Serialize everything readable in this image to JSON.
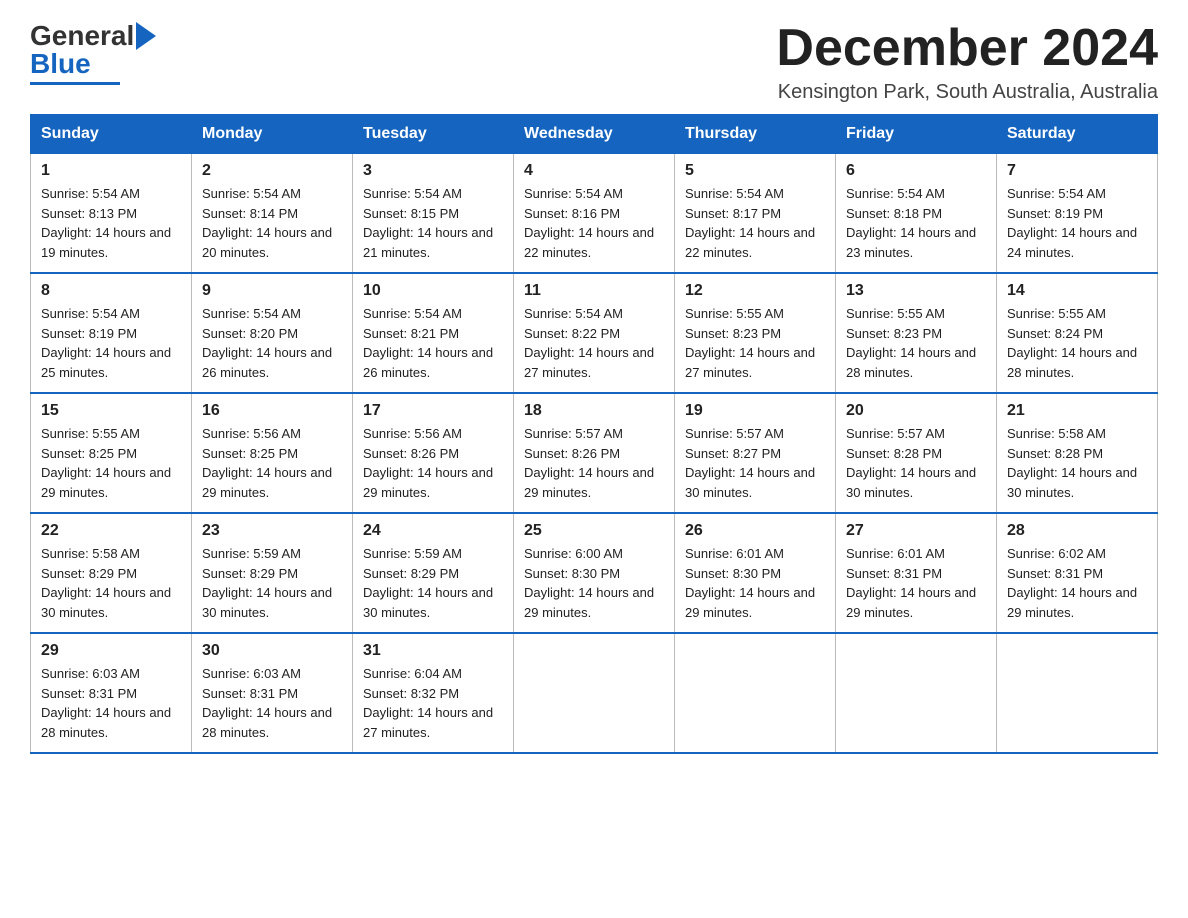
{
  "logo": {
    "general": "General",
    "blue": "Blue"
  },
  "header": {
    "month": "December 2024",
    "location": "Kensington Park, South Australia, Australia"
  },
  "weekdays": [
    "Sunday",
    "Monday",
    "Tuesday",
    "Wednesday",
    "Thursday",
    "Friday",
    "Saturday"
  ],
  "weeks": [
    [
      {
        "day": "1",
        "sunrise": "5:54 AM",
        "sunset": "8:13 PM",
        "daylight": "14 hours and 19 minutes."
      },
      {
        "day": "2",
        "sunrise": "5:54 AM",
        "sunset": "8:14 PM",
        "daylight": "14 hours and 20 minutes."
      },
      {
        "day": "3",
        "sunrise": "5:54 AM",
        "sunset": "8:15 PM",
        "daylight": "14 hours and 21 minutes."
      },
      {
        "day": "4",
        "sunrise": "5:54 AM",
        "sunset": "8:16 PM",
        "daylight": "14 hours and 22 minutes."
      },
      {
        "day": "5",
        "sunrise": "5:54 AM",
        "sunset": "8:17 PM",
        "daylight": "14 hours and 22 minutes."
      },
      {
        "day": "6",
        "sunrise": "5:54 AM",
        "sunset": "8:18 PM",
        "daylight": "14 hours and 23 minutes."
      },
      {
        "day": "7",
        "sunrise": "5:54 AM",
        "sunset": "8:19 PM",
        "daylight": "14 hours and 24 minutes."
      }
    ],
    [
      {
        "day": "8",
        "sunrise": "5:54 AM",
        "sunset": "8:19 PM",
        "daylight": "14 hours and 25 minutes."
      },
      {
        "day": "9",
        "sunrise": "5:54 AM",
        "sunset": "8:20 PM",
        "daylight": "14 hours and 26 minutes."
      },
      {
        "day": "10",
        "sunrise": "5:54 AM",
        "sunset": "8:21 PM",
        "daylight": "14 hours and 26 minutes."
      },
      {
        "day": "11",
        "sunrise": "5:54 AM",
        "sunset": "8:22 PM",
        "daylight": "14 hours and 27 minutes."
      },
      {
        "day": "12",
        "sunrise": "5:55 AM",
        "sunset": "8:23 PM",
        "daylight": "14 hours and 27 minutes."
      },
      {
        "day": "13",
        "sunrise": "5:55 AM",
        "sunset": "8:23 PM",
        "daylight": "14 hours and 28 minutes."
      },
      {
        "day": "14",
        "sunrise": "5:55 AM",
        "sunset": "8:24 PM",
        "daylight": "14 hours and 28 minutes."
      }
    ],
    [
      {
        "day": "15",
        "sunrise": "5:55 AM",
        "sunset": "8:25 PM",
        "daylight": "14 hours and 29 minutes."
      },
      {
        "day": "16",
        "sunrise": "5:56 AM",
        "sunset": "8:25 PM",
        "daylight": "14 hours and 29 minutes."
      },
      {
        "day": "17",
        "sunrise": "5:56 AM",
        "sunset": "8:26 PM",
        "daylight": "14 hours and 29 minutes."
      },
      {
        "day": "18",
        "sunrise": "5:57 AM",
        "sunset": "8:26 PM",
        "daylight": "14 hours and 29 minutes."
      },
      {
        "day": "19",
        "sunrise": "5:57 AM",
        "sunset": "8:27 PM",
        "daylight": "14 hours and 30 minutes."
      },
      {
        "day": "20",
        "sunrise": "5:57 AM",
        "sunset": "8:28 PM",
        "daylight": "14 hours and 30 minutes."
      },
      {
        "day": "21",
        "sunrise": "5:58 AM",
        "sunset": "8:28 PM",
        "daylight": "14 hours and 30 minutes."
      }
    ],
    [
      {
        "day": "22",
        "sunrise": "5:58 AM",
        "sunset": "8:29 PM",
        "daylight": "14 hours and 30 minutes."
      },
      {
        "day": "23",
        "sunrise": "5:59 AM",
        "sunset": "8:29 PM",
        "daylight": "14 hours and 30 minutes."
      },
      {
        "day": "24",
        "sunrise": "5:59 AM",
        "sunset": "8:29 PM",
        "daylight": "14 hours and 30 minutes."
      },
      {
        "day": "25",
        "sunrise": "6:00 AM",
        "sunset": "8:30 PM",
        "daylight": "14 hours and 29 minutes."
      },
      {
        "day": "26",
        "sunrise": "6:01 AM",
        "sunset": "8:30 PM",
        "daylight": "14 hours and 29 minutes."
      },
      {
        "day": "27",
        "sunrise": "6:01 AM",
        "sunset": "8:31 PM",
        "daylight": "14 hours and 29 minutes."
      },
      {
        "day": "28",
        "sunrise": "6:02 AM",
        "sunset": "8:31 PM",
        "daylight": "14 hours and 29 minutes."
      }
    ],
    [
      {
        "day": "29",
        "sunrise": "6:03 AM",
        "sunset": "8:31 PM",
        "daylight": "14 hours and 28 minutes."
      },
      {
        "day": "30",
        "sunrise": "6:03 AM",
        "sunset": "8:31 PM",
        "daylight": "14 hours and 28 minutes."
      },
      {
        "day": "31",
        "sunrise": "6:04 AM",
        "sunset": "8:32 PM",
        "daylight": "14 hours and 27 minutes."
      },
      null,
      null,
      null,
      null
    ]
  ]
}
